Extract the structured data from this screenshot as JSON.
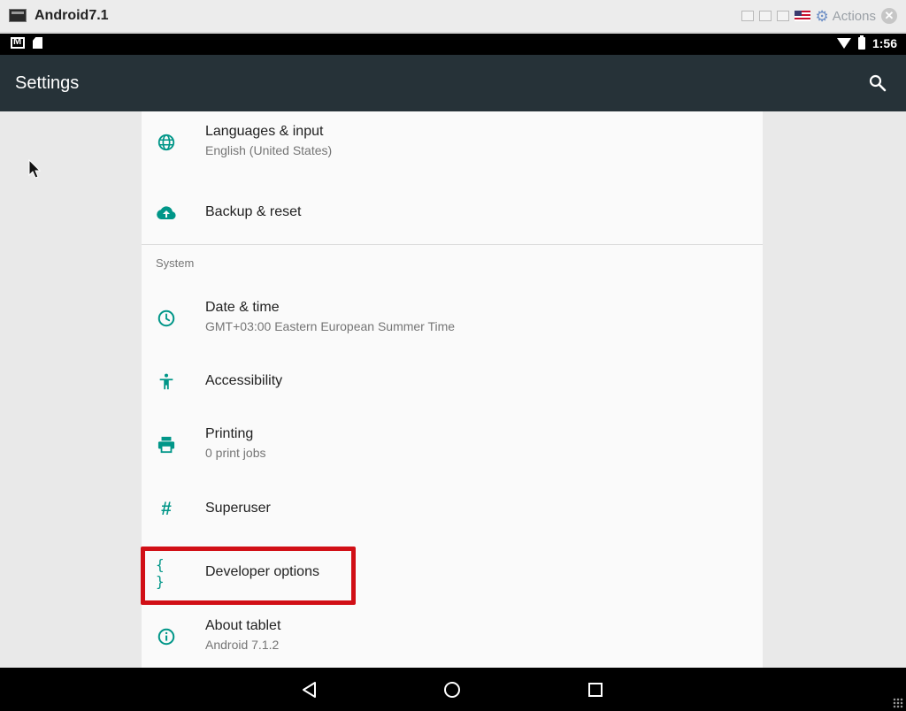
{
  "window": {
    "title": "Android7.1",
    "actions_label": "Actions"
  },
  "status_bar": {
    "time": "1:56"
  },
  "action_bar": {
    "title": "Settings"
  },
  "items_top": [
    {
      "title": "Languages & input",
      "subtitle": "English (United States)",
      "icon": "globe-icon"
    },
    {
      "title": "Backup & reset",
      "subtitle": "",
      "icon": "cloud-upload-icon"
    }
  ],
  "section": {
    "header": "System"
  },
  "items_system": [
    {
      "title": "Date & time",
      "subtitle": "GMT+03:00 Eastern European Summer Time",
      "icon": "clock-icon"
    },
    {
      "title": "Accessibility",
      "subtitle": "",
      "icon": "accessibility-icon"
    },
    {
      "title": "Printing",
      "subtitle": "0 print jobs",
      "icon": "printer-icon"
    },
    {
      "title": "Superuser",
      "subtitle": "",
      "icon": "hash-icon"
    },
    {
      "title": "Developer options",
      "subtitle": "",
      "icon": "braces-icon"
    },
    {
      "title": "About tablet",
      "subtitle": "Android 7.1.2",
      "icon": "info-icon"
    }
  ],
  "colors": {
    "accent": "#009688",
    "action_bar": "#263238",
    "highlight": "#d10f16"
  }
}
